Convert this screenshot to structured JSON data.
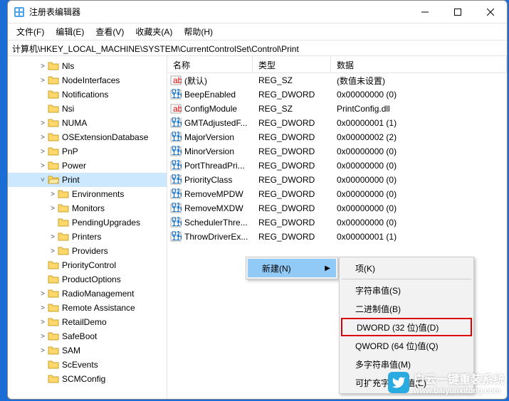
{
  "window": {
    "title": "注册表编辑器"
  },
  "menu": {
    "file": "文件(F)",
    "edit": "编辑(E)",
    "view": "查看(V)",
    "favorites": "收藏夹(A)",
    "help": "帮助(H)"
  },
  "address": "计算机\\HKEY_LOCAL_MACHINE\\SYSTEM\\CurrentControlSet\\Control\\Print",
  "tree": [
    {
      "label": "Nls",
      "indent": 3,
      "exp": ">"
    },
    {
      "label": "NodeInterfaces",
      "indent": 3,
      "exp": ">"
    },
    {
      "label": "Notifications",
      "indent": 3,
      "exp": ""
    },
    {
      "label": "Nsi",
      "indent": 3,
      "exp": ""
    },
    {
      "label": "NUMA",
      "indent": 3,
      "exp": ">"
    },
    {
      "label": "OSExtensionDatabase",
      "indent": 3,
      "exp": ">"
    },
    {
      "label": "PnP",
      "indent": 3,
      "exp": ">"
    },
    {
      "label": "Power",
      "indent": 3,
      "exp": ">"
    },
    {
      "label": "Print",
      "indent": 3,
      "exp": "v",
      "selected": true,
      "open": true
    },
    {
      "label": "Environments",
      "indent": 4,
      "exp": ">"
    },
    {
      "label": "Monitors",
      "indent": 4,
      "exp": ">"
    },
    {
      "label": "PendingUpgrades",
      "indent": 4,
      "exp": ""
    },
    {
      "label": "Printers",
      "indent": 4,
      "exp": ">"
    },
    {
      "label": "Providers",
      "indent": 4,
      "exp": ">"
    },
    {
      "label": "PriorityControl",
      "indent": 3,
      "exp": ""
    },
    {
      "label": "ProductOptions",
      "indent": 3,
      "exp": ""
    },
    {
      "label": "RadioManagement",
      "indent": 3,
      "exp": ">"
    },
    {
      "label": "Remote Assistance",
      "indent": 3,
      "exp": ">"
    },
    {
      "label": "RetailDemo",
      "indent": 3,
      "exp": ">"
    },
    {
      "label": "SafeBoot",
      "indent": 3,
      "exp": ">"
    },
    {
      "label": "SAM",
      "indent": 3,
      "exp": ">"
    },
    {
      "label": "ScEvents",
      "indent": 3,
      "exp": ""
    },
    {
      "label": "SCMConfig",
      "indent": 3,
      "exp": ""
    }
  ],
  "columns": {
    "name": "名称",
    "type": "类型",
    "data": "数据"
  },
  "values": [
    {
      "icon": "sz",
      "name": "(默认)",
      "type": "REG_SZ",
      "data": "(数值未设置)"
    },
    {
      "icon": "bin",
      "name": "BeepEnabled",
      "type": "REG_DWORD",
      "data": "0x00000000 (0)"
    },
    {
      "icon": "sz",
      "name": "ConfigModule",
      "type": "REG_SZ",
      "data": "PrintConfig.dll"
    },
    {
      "icon": "bin",
      "name": "GMTAdjustedF...",
      "type": "REG_DWORD",
      "data": "0x00000001 (1)"
    },
    {
      "icon": "bin",
      "name": "MajorVersion",
      "type": "REG_DWORD",
      "data": "0x00000002 (2)"
    },
    {
      "icon": "bin",
      "name": "MinorVersion",
      "type": "REG_DWORD",
      "data": "0x00000000 (0)"
    },
    {
      "icon": "bin",
      "name": "PortThreadPri...",
      "type": "REG_DWORD",
      "data": "0x00000000 (0)"
    },
    {
      "icon": "bin",
      "name": "PriorityClass",
      "type": "REG_DWORD",
      "data": "0x00000000 (0)"
    },
    {
      "icon": "bin",
      "name": "RemoveMPDW",
      "type": "REG_DWORD",
      "data": "0x00000000 (0)"
    },
    {
      "icon": "bin",
      "name": "RemoveMXDW",
      "type": "REG_DWORD",
      "data": "0x00000000 (0)"
    },
    {
      "icon": "bin",
      "name": "SchedulerThre...",
      "type": "REG_DWORD",
      "data": "0x00000000 (0)"
    },
    {
      "icon": "bin",
      "name": "ThrowDriverEx...",
      "type": "REG_DWORD",
      "data": "0x00000001 (1)"
    }
  ],
  "context1": {
    "new": "新建(N)"
  },
  "context2": {
    "key": "项(K)",
    "string": "字符串值(S)",
    "binary": "二进制值(B)",
    "dword": "DWORD (32 位)值(D)",
    "qword": "QWORD (64 位)值(Q)",
    "multi": "多字符串值(M)",
    "expand": "可扩充字符串值(E)"
  },
  "watermark": {
    "text1": "白云一键重装系统",
    "text2": "www.baiyunxitong.com"
  }
}
